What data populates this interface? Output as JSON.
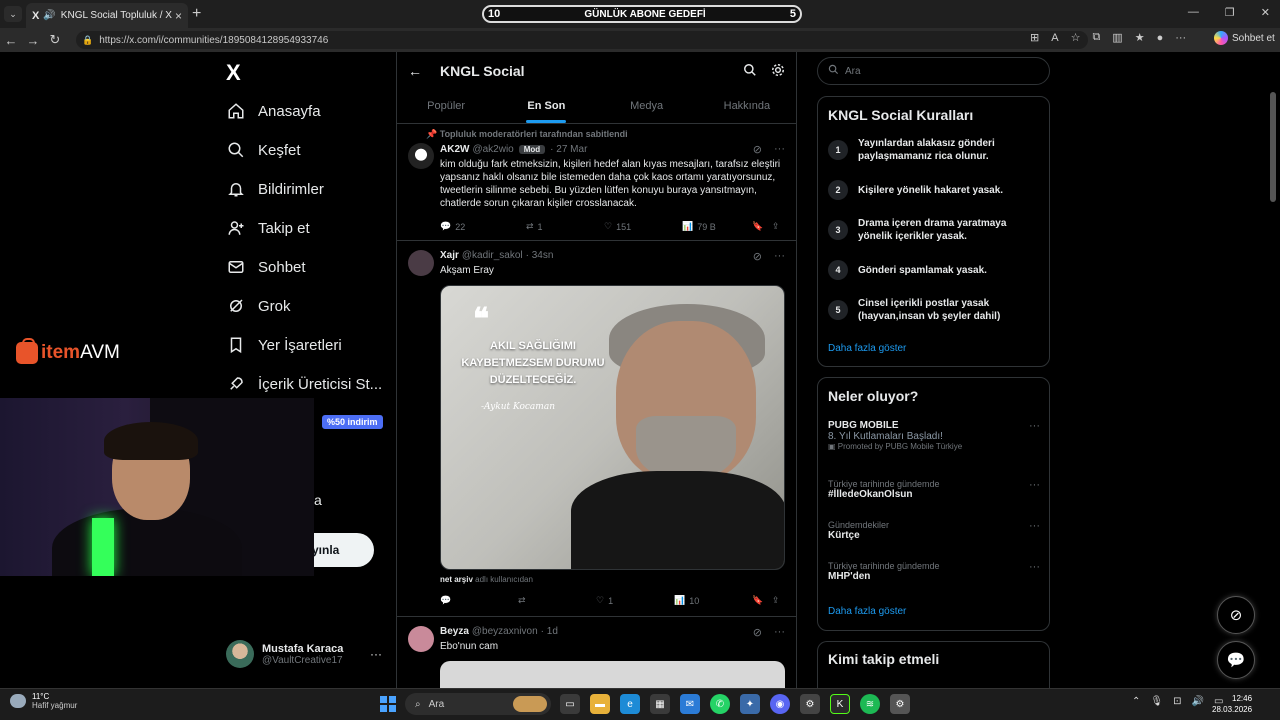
{
  "browser": {
    "tab_title": "KNGL Social Topluluk / X",
    "tab_logo": "X",
    "url": "https://x.com/i/communities/1895084128954933746",
    "copilot_label": "Sohbet et"
  },
  "goal_overlay": {
    "left": "10",
    "label": "GÜNLÜK ABONE GEDEFİ",
    "right": "5"
  },
  "left_nav": {
    "logo": "X",
    "items": [
      {
        "label": "Anasayfa",
        "icon": "home-icon"
      },
      {
        "label": "Keşfet",
        "icon": "search-icon"
      },
      {
        "label": "Bildirimler",
        "icon": "bell-icon"
      },
      {
        "label": "Takip et",
        "icon": "follow-icon"
      },
      {
        "label": "Sohbet",
        "icon": "mail-icon"
      },
      {
        "label": "Grok",
        "icon": "grok-icon"
      },
      {
        "label": "Yer İşaretleri",
        "icon": "bookmark-icon"
      },
      {
        "label": "İçerik Üreticisi St...",
        "icon": "rocket-icon"
      }
    ],
    "discount_badge": "%50 indirim",
    "partial_item": "a",
    "post_button": "yınla",
    "user": {
      "name": "Mustafa Karaca",
      "handle": "@VaultCreative17"
    }
  },
  "overlay_brand": {
    "prefix": "item",
    "suffix": "AVM"
  },
  "community": {
    "title": "KNGL Social",
    "tabs": [
      "Popüler",
      "En Son",
      "Medya",
      "Hakkında"
    ],
    "active_tab": "En Son"
  },
  "posts": [
    {
      "pinned": "Topluluk moderatörleri tarafından sabitlendi",
      "name": "AK2W",
      "handle": "@ak2wio",
      "badge": "Mod",
      "time": "· 27 Mar",
      "text": "kim olduğu fark etmeksizin, kişileri hedef alan kıyas mesajları, tarafsız eleştiri yapsanız haklı olsanız bile istemeden daha çok kaos ortamı yaratıyorsunuz, tweetlerin silinme sebebi. Bu yüzden lütfen konuyu buraya yansıtmayın, chatlerde sorun çıkaran kişiler crosslanacak.",
      "replies": "22",
      "reposts": "1",
      "likes": "151",
      "views": "79 B"
    },
    {
      "name": "Xajr",
      "handle": "@kadir_sakol",
      "time": "· 34sn",
      "text": "Akşam Eray",
      "image_quote": "AKIL SAĞLIĞIMI KAYBETMEZSEM DURUMU DÜZELTECEĞİZ.",
      "image_signature": "-Aykut Kocaman",
      "credit_user": "net arşiv",
      "credit_suffix": "adlı kullanıcıdan",
      "replies": "",
      "reposts": "",
      "likes": "1",
      "views": "10"
    },
    {
      "name": "Beyza",
      "handle": "@beyzaxnivon",
      "time": "· 1d",
      "text": "Ebo'nun cam"
    }
  ],
  "right": {
    "search_placeholder": "Ara",
    "rules_title": "KNGL Social Kuralları",
    "rules": [
      "Yayınlardan alakasız gönderi paylaşmamanız rica olunur.",
      "Kişilere yönelik hakaret yasak.",
      "Drama içeren drama yaratmaya yönelik içerikler yasak.",
      "Gönderi spamlamak yasak.",
      "Cinsel içerikli postlar yasak (hayvan,insan vb şeyler dahil)"
    ],
    "show_more": "Daha fazla göster",
    "trends_title": "Neler oluyor?",
    "trends": [
      {
        "context": "",
        "title": "PUBG MOBILE",
        "sub": "8. Yıl Kutlamaları Başladı!",
        "promo": "Promoted by PUBG Mobile Türkiye"
      },
      {
        "context": "Türkiye tarihinde gündemde",
        "title": "#İlledeOkanOlsun"
      },
      {
        "context": "Gündemdekiler",
        "title": "Kürtçe"
      },
      {
        "context": "Türkiye tarihinde gündemde",
        "title": "MHP'den"
      }
    ],
    "follow_title": "Kimi takip etmeli"
  },
  "taskbar": {
    "temperature": "11°C",
    "weather": "Hafif yağmur",
    "search": "Ara",
    "time": "12:46",
    "date": "28.03.2026"
  },
  "colors": {
    "accent": "#1d9bf0",
    "background": "#000000",
    "border": "#2f3336"
  }
}
